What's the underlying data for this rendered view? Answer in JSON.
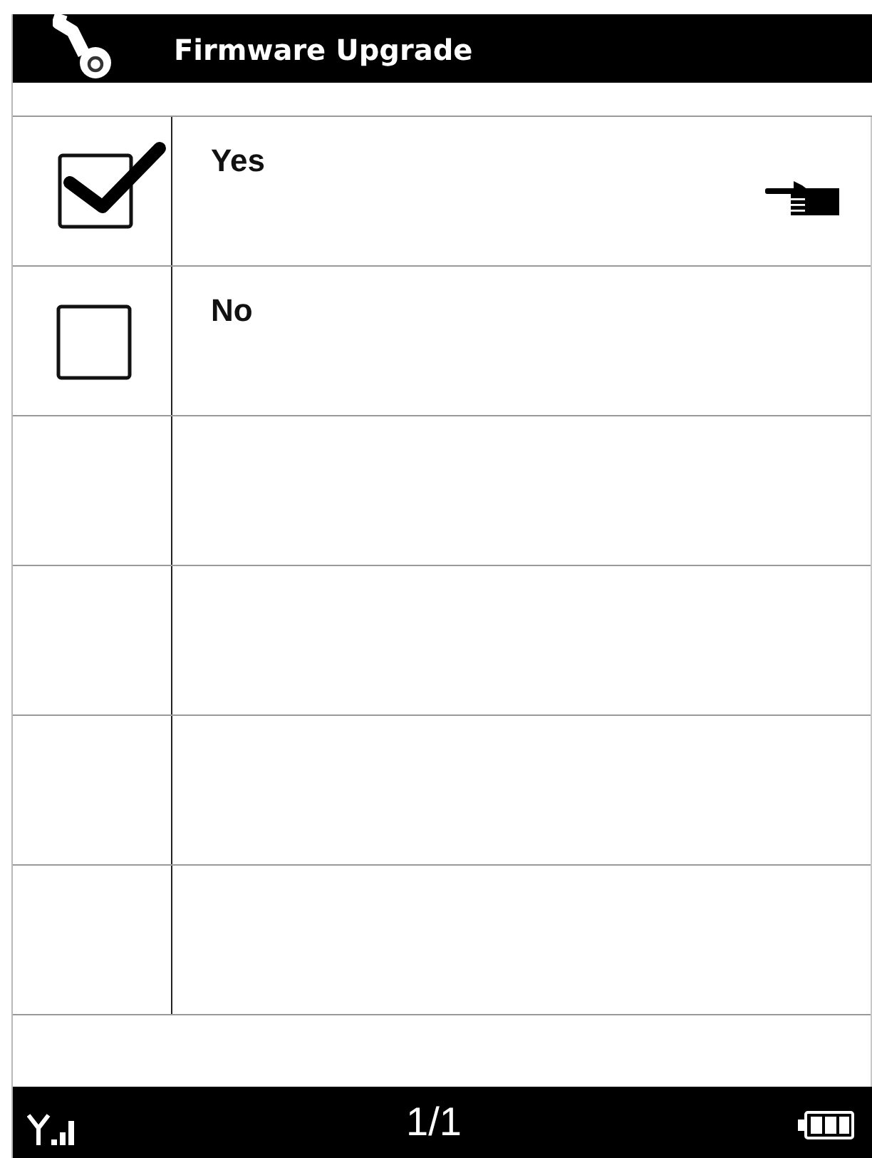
{
  "title_bar": {
    "title": "Firmware Upgrade"
  },
  "options": [
    {
      "label": "Yes",
      "checked": true,
      "selected": true
    },
    {
      "label": "No",
      "checked": false,
      "selected": false
    }
  ],
  "status_bar": {
    "page": "1/1"
  }
}
